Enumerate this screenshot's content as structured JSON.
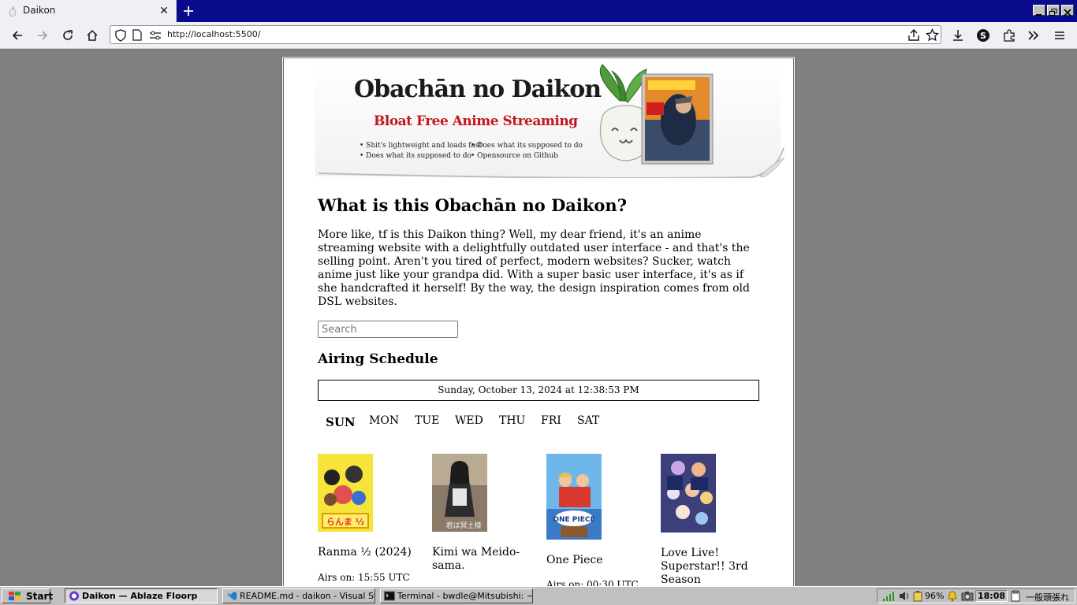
{
  "browser": {
    "tab_title": "Daikon",
    "url": "http://localhost:5500/"
  },
  "banner": {
    "title": "Obachān no Daikon",
    "subtitle": "Bloat Free Anime Streaming",
    "bullets": [
      "• Shit's lightweight and loads fast",
      "• Does what its supposed to do",
      "• Does what its supposed to do",
      "• Opensource on Github"
    ]
  },
  "main": {
    "heading": "What is this Obachān no Daikon?",
    "intro": "More like, tf is this Daikon thing? Well, my dear friend, it's an anime streaming website with a delightfully outdated user interface - and that's the selling point. Aren't you tired of perfect, modern websites? Sucker, watch anime just like your grandpa did. With a super basic user interface, it's as if she handcrafted it herself! By the way, the design inspiration comes from old DSL websites.",
    "search_placeholder": "Search",
    "schedule_heading": "Airing Schedule",
    "current_datetime": "Sunday, October 13, 2024 at 12:38:53 PM",
    "days": [
      "SUN",
      "MON",
      "TUE",
      "WED",
      "THU",
      "FRI",
      "SAT"
    ],
    "active_day": "SUN",
    "shows": [
      {
        "title": "Ranma ½ (2024)",
        "airs": "Airs on: 15:55 UTC"
      },
      {
        "title": "Kimi wa Meido-sama.",
        "airs": ""
      },
      {
        "title": "One Piece",
        "airs": "Airs on: 00:30 UTC"
      },
      {
        "title": "Love Live! Superstar!! 3rd Season",
        "airs": ""
      }
    ]
  },
  "taskbar": {
    "start_label": "Start",
    "tasks": [
      "Daikon — Ablaze Floorp",
      "README.md - daikon - Visual St...",
      "Terminal - bwdle@Mitsubishi: ~/P..."
    ],
    "battery": "96%",
    "clock": "18:08",
    "ime": "一般頭張れ"
  },
  "colors": {
    "titlebar": "#0a0a8c",
    "desktop": "#808080",
    "subtitle_red": "#c4161c"
  }
}
